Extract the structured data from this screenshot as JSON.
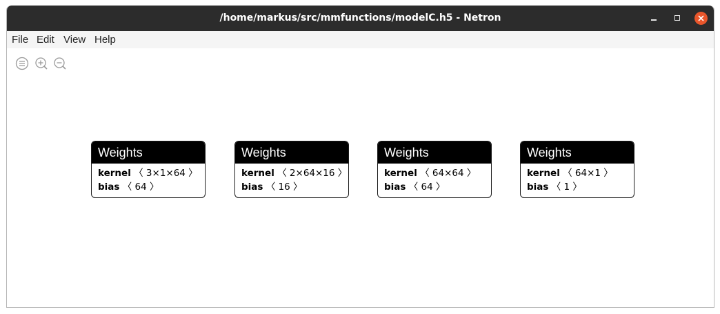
{
  "window": {
    "title": "/home/markus/src/mmfunctions/modelC.h5 - Netron",
    "controls": {
      "minimize": "minimize-icon",
      "maximize": "maximize-icon",
      "close": "close-icon",
      "close_color": "#e9562b"
    }
  },
  "menu": {
    "items": [
      {
        "label": "File"
      },
      {
        "label": "Edit"
      },
      {
        "label": "View"
      },
      {
        "label": "Help"
      }
    ]
  },
  "toolbar": {
    "icons": [
      "list-icon",
      "zoom-in-icon",
      "zoom-out-icon"
    ]
  },
  "graph": {
    "nodes": [
      {
        "title": "Weights",
        "attributes": [
          {
            "name": "kernel",
            "value": "〈 3×1×64 〉"
          },
          {
            "name": "bias",
            "value": "〈 64 〉"
          }
        ]
      },
      {
        "title": "Weights",
        "attributes": [
          {
            "name": "kernel",
            "value": "〈 2×64×16 〉"
          },
          {
            "name": "bias",
            "value": "〈 16 〉"
          }
        ]
      },
      {
        "title": "Weights",
        "attributes": [
          {
            "name": "kernel",
            "value": "〈 64×64 〉"
          },
          {
            "name": "bias",
            "value": "〈 64 〉"
          }
        ]
      },
      {
        "title": "Weights",
        "attributes": [
          {
            "name": "kernel",
            "value": "〈 64×1 〉"
          },
          {
            "name": "bias",
            "value": "〈 1 〉"
          }
        ]
      }
    ],
    "header_color": "#000000"
  }
}
